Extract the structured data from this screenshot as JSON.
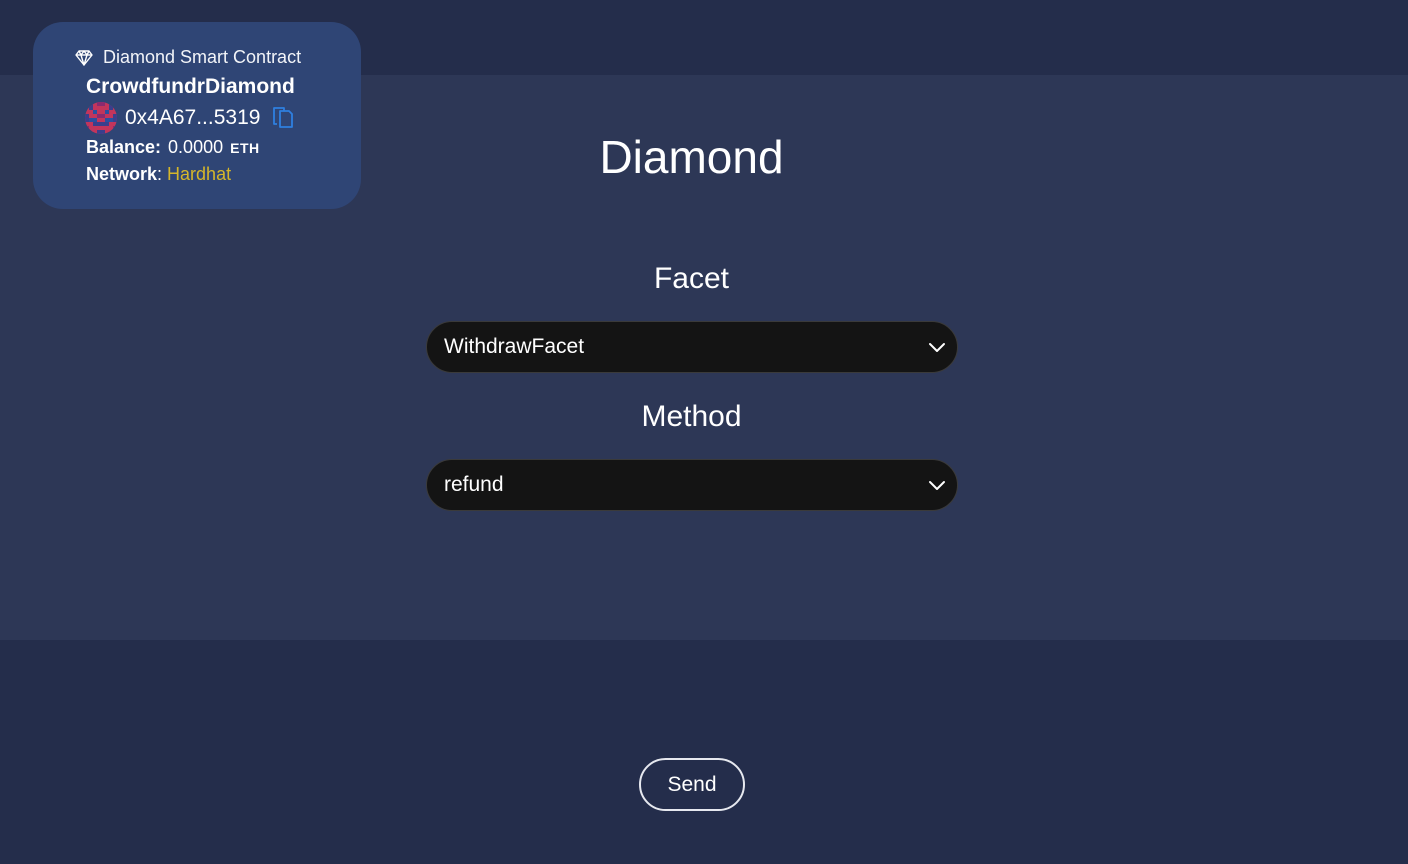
{
  "contract_card": {
    "header": "Diamond Smart Contract",
    "name": "CrowdfundrDiamond",
    "address": "0x4A67...5319",
    "balance_label": "Balance:",
    "balance_value": "0.0000",
    "balance_unit": "ETH",
    "network_label": "Network",
    "network_separator": ":",
    "network_value": "Hardhat",
    "network_color": "#d4b62a",
    "icons": [
      "diamond-icon",
      "avatar",
      "copy-icon"
    ]
  },
  "main": {
    "title": "Diamond",
    "facet_label": "Facet",
    "facet_selected": "WithdrawFacet",
    "method_label": "Method",
    "method_selected": "refund"
  },
  "actions": {
    "send_label": "Send"
  },
  "colors": {
    "background": "#242d4b",
    "panel": "#2d3756",
    "card": "#2f4575",
    "select_bg": "#141414",
    "copy_accent": "#2f7fe0"
  }
}
